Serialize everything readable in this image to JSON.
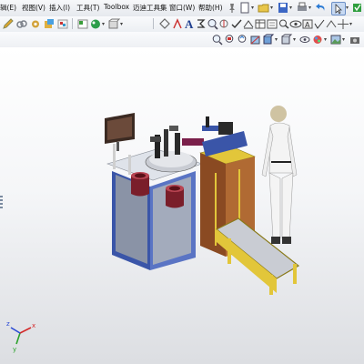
{
  "menu": {
    "items": [
      "辑(E)",
      "视图(V)",
      "插入(I)",
      "工具(T)",
      "Toolbox",
      "迈迪工具集",
      "窗口(W)",
      "帮助(H)"
    ]
  },
  "toolbar_icons": {
    "row1": [
      "pin-icon",
      "new-document-icon",
      "open-icon",
      "save-icon",
      "print-icon",
      "undo-icon",
      "select-icon",
      "rebuild-icon"
    ],
    "row2": [
      "pencil-icon",
      "link-icon",
      "gear-icon",
      "part-icon",
      "assembly-icon",
      "sketch-icon",
      "dimension-icon",
      "text-icon",
      "zoom-icon",
      "view-icon"
    ],
    "row3": [
      "zoom-fit-icon",
      "zoom-area-icon",
      "rotate-icon",
      "section-icon",
      "display-style-icon",
      "appearance-icon",
      "scene-icon"
    ]
  },
  "triad": {
    "axes": [
      "y",
      "x",
      "z"
    ],
    "colors": {
      "x": "#d42a2a",
      "y": "#2aa12a",
      "z": "#2a4ad4"
    }
  }
}
